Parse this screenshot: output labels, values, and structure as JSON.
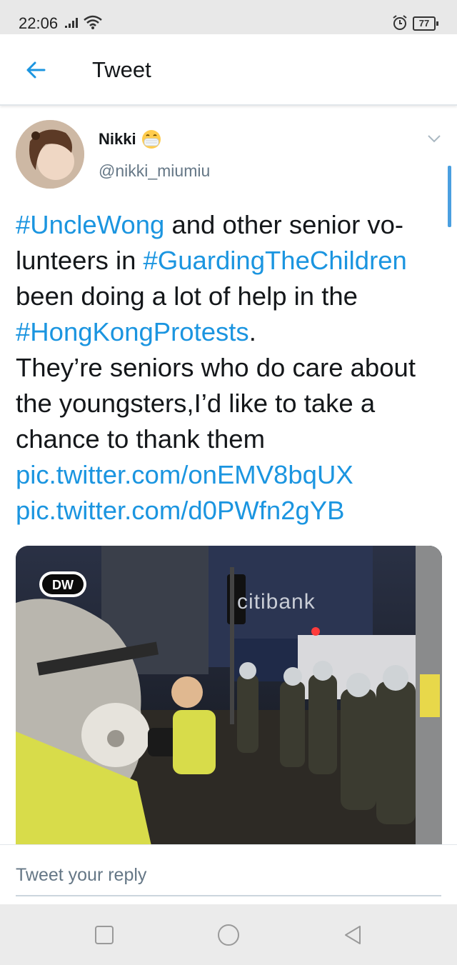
{
  "status_bar": {
    "time": "22:06",
    "battery": "77"
  },
  "header": {
    "title": "Tweet"
  },
  "tweet": {
    "display_name": "Nikki",
    "handle": "@nikki_miumiu",
    "text_segments": [
      {
        "text": "#UncleWong",
        "type": "link"
      },
      {
        "text": " and other senior vo-",
        "type": "text"
      },
      {
        "text": "lunteers in ",
        "type": "text"
      },
      {
        "text": "#GuardingTheChildren",
        "type": "link"
      },
      {
        "text": "been doing a lot of help in the",
        "type": "text"
      },
      {
        "text": "#HongKongProtests",
        "type": "link"
      },
      {
        "text": ".",
        "type": "text"
      },
      {
        "text": "They’re seniors who do care about the youngsters,I’d like to take a chance to thank them",
        "type": "text"
      },
      {
        "text": "pic.twitter.com/onEMV8bqUX",
        "type": "link"
      },
      {
        "text": "pic.twitter.com/d0PWfn2gYB",
        "type": "link"
      }
    ],
    "media": {
      "logo_text": "DW",
      "sign_text": "citibank"
    }
  },
  "reply": {
    "placeholder": "Tweet your reply"
  },
  "colors": {
    "link": "#1b95e0",
    "secondary_text": "#657786",
    "status_bar_bg": "#e8e8e8"
  },
  "icons": [
    "signal-icon",
    "wifi-icon",
    "alarm-icon",
    "back-arrow-icon",
    "mask-emoji-icon",
    "chevron-down-icon",
    "square-nav-icon",
    "circle-nav-icon",
    "triangle-back-nav-icon"
  ]
}
